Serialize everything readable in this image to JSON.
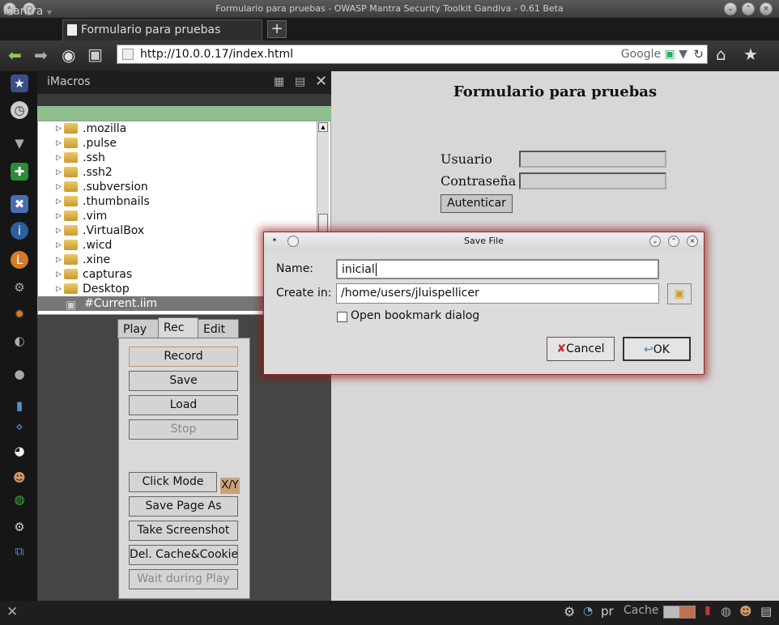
{
  "window": {
    "title": "Formulario para pruebas - OWASP Mantra Security Toolkit Gandiva - 0.61 Beta"
  },
  "tabbar": {
    "app_label": "Mantra",
    "tab_title": "Formulario para pruebas",
    "new_tab": "+"
  },
  "navbar": {
    "url": "http://10.0.0.17/index.html",
    "search_engine": "Google"
  },
  "imacros": {
    "title": "iMacros",
    "tree": [
      {
        "name": ".mozilla"
      },
      {
        "name": ".pulse"
      },
      {
        "name": ".ssh"
      },
      {
        "name": ".ssh2"
      },
      {
        "name": ".subversion"
      },
      {
        "name": ".thumbnails"
      },
      {
        "name": ".vim"
      },
      {
        "name": ".VirtualBox"
      },
      {
        "name": ".wicd"
      },
      {
        "name": ".xine"
      },
      {
        "name": "capturas"
      },
      {
        "name": "Desktop"
      }
    ],
    "current_file": "#Current.iim",
    "tabs": {
      "play": "Play",
      "rec": "Rec",
      "edit": "Edit"
    },
    "buttons": {
      "record": "Record",
      "save": "Save",
      "load": "Load",
      "stop": "Stop",
      "click_mode": "Click Mode",
      "xy": "X/Y",
      "save_page_as": "Save Page As",
      "take_screenshot": "Take Screenshot",
      "del_cache": "Del. Cache&Cookies",
      "wait_during_play": "Wait during Play"
    }
  },
  "page": {
    "title": "Formulario para pruebas",
    "user_label": "Usuario",
    "password_label": "Contraseña",
    "submit": "Autenticar"
  },
  "dialog": {
    "title": "Save File",
    "name_label": "Name:",
    "name_value": "inicial",
    "create_in_label": "Create in:",
    "create_in_value": "/home/users/jluispellicer",
    "bookmark_label": "Open bookmark dialog",
    "cancel": "Cancel",
    "ok": "OK"
  },
  "statusbar": {
    "cache_label": "Cache",
    "pr": "pr"
  },
  "colors": {
    "accent_green": "#8fbf8f",
    "dialog_glow": "#8a2a2a"
  }
}
